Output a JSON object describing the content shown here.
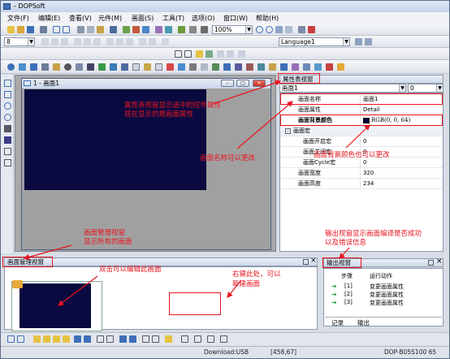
{
  "window": {
    "title": "- DOPSoft"
  },
  "menu": [
    "文件(F)",
    "编辑(E)",
    "查看(V)",
    "元件(M)",
    "画面(S)",
    "工具(T)",
    "选项(O)",
    "窗口(W)",
    "帮助(H)"
  ],
  "toolbar": {
    "zoom_value": "100%",
    "font_size_value": "8",
    "language_value": "Language1"
  },
  "editor": {
    "child_title": "1 - 画面1"
  },
  "properties": {
    "panel_title": "属性表视窗",
    "selector_value": "画面1",
    "selector_number": "0",
    "rows": [
      {
        "key": "画面名称",
        "value": "画面1"
      },
      {
        "key": "画面属性",
        "value": "Detail"
      },
      {
        "key": "画面背景颜色",
        "value": "RGB(0, 0, 64)"
      },
      {
        "key": "画面宏",
        "value": ""
      },
      {
        "key": "画面开启宏",
        "value": "0"
      },
      {
        "key": "画面关闭宏",
        "value": "0"
      },
      {
        "key": "画面Cycle宏",
        "value": "0"
      },
      {
        "key": "画面宽度",
        "value": "320"
      },
      {
        "key": "画面高度",
        "value": "234"
      }
    ]
  },
  "screen_manager": {
    "panel_title": "画面管理视窗"
  },
  "output": {
    "panel_title": "输出视窗",
    "col_step": "步骤",
    "col_action": "运行动作",
    "rows": [
      {
        "step": "[1]",
        "action": "变更画面属性"
      },
      {
        "step": "[2]",
        "action": "变更画面属性"
      },
      {
        "step": "[3]",
        "action": "变更画面属性"
      }
    ],
    "tabs": [
      "记录",
      "输出"
    ]
  },
  "annotations": {
    "prop_note_1": "属性表视窗显示选中的控件属性",
    "prop_note_2": "现在显示的是画面属性",
    "name_note": "画面名称可以更改",
    "bg_note": "画面背景颜色也可以更改",
    "output_note_1": "输出视窗显示画面编译是否成功",
    "output_note_2": "以及错误信息",
    "manager_note_1": "画面管理视窗",
    "manager_note_2": "显示所有的画面",
    "dblclick_note": "双击可以编辑此画面",
    "rightclick_note_1": "右键此处，可以",
    "rightclick_note_2": "新建画面"
  },
  "status": {
    "download": "Download:USB",
    "coords": "[458,67]",
    "model": "DOP-B05S100 65"
  },
  "colors": {
    "screen_bg": "#0a0a40",
    "annotation": "#e8141e"
  }
}
